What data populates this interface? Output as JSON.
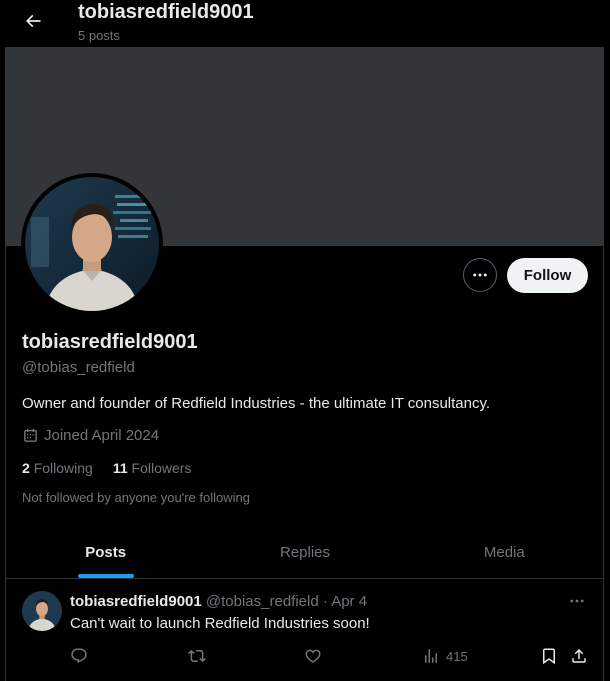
{
  "header": {
    "title": "tobiasredfield9001",
    "subtitle": "5 posts"
  },
  "profile": {
    "name": "tobiasredfield9001",
    "handle": "@tobias_redfield",
    "bio": "Owner and founder of Redfield Industries - the ultimate IT consultancy.",
    "joined": "Joined April 2024",
    "following_count": "2",
    "following_label": "Following",
    "followers_count": "11",
    "followers_label": "Followers",
    "not_followed_note": "Not followed by anyone you're following",
    "follow_button": "Follow"
  },
  "tabs": [
    {
      "label": "Posts",
      "active": true
    },
    {
      "label": "Replies",
      "active": false
    },
    {
      "label": "Media",
      "active": false
    }
  ],
  "post": {
    "author_name": "tobiasredfield9001",
    "author_handle": "@tobias_redfield",
    "separator": "·",
    "date": "Apr 4",
    "text": "Can't wait to launch Redfield Industries soon!",
    "views": "415"
  },
  "colors": {
    "background": "#000000",
    "banner": "#333639",
    "accent": "#1d9bf0",
    "muted_text": "#71767b",
    "primary_text": "#e7e9ea"
  }
}
